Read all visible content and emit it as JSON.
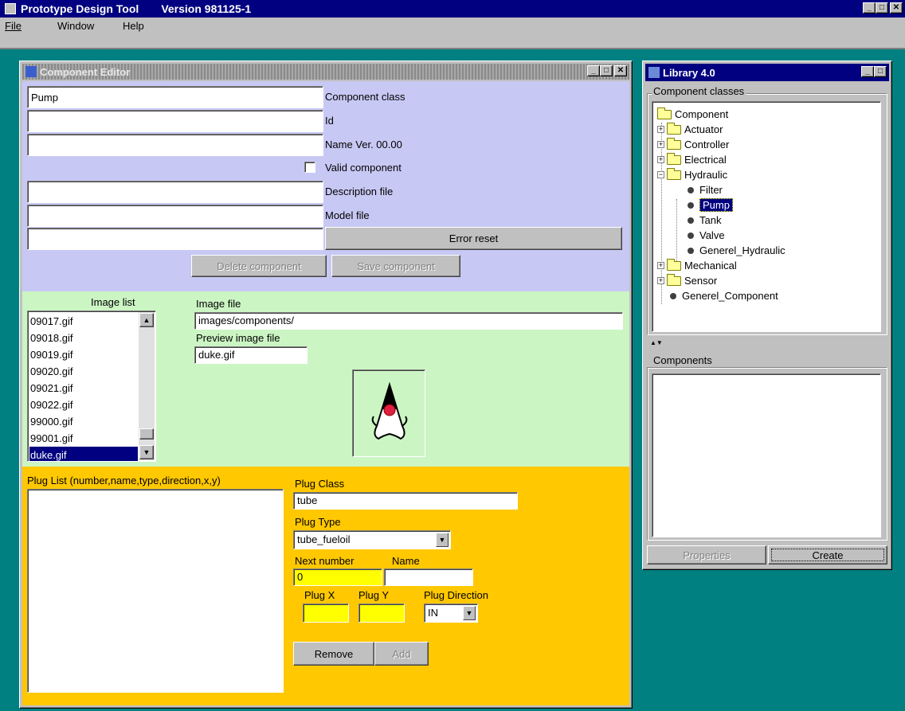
{
  "app": {
    "title": "Prototype Design Tool",
    "version": "Version 981125-1",
    "menu": [
      "File",
      "Window",
      "Help"
    ]
  },
  "colors": {
    "desktop": "#008080",
    "editor_top": "#c8c8f5",
    "editor_mid": "#ccf5c4",
    "editor_bottom": "#ffc800",
    "titlebar_active": "#000080"
  },
  "editor": {
    "title": "Component Editor",
    "component_class_value": "Pump",
    "component_class_label": "Component class",
    "id_value": "",
    "id_label": "Id",
    "name_value": "",
    "name_label": "Name Ver. 00.00",
    "valid_label": "Valid component",
    "valid_checked": false,
    "description_value": "",
    "description_label": "Description file",
    "model_value": "",
    "model_label": "Model file",
    "error_value": "",
    "error_reset_label": "Error reset",
    "delete_label": "Delete component",
    "save_label": "Save component",
    "image_list_label": "Image list",
    "image_list": [
      "09017.gif",
      "09018.gif",
      "09019.gif",
      "09020.gif",
      "09021.gif",
      "09022.gif",
      "99000.gif",
      "99001.gif",
      "duke.gif"
    ],
    "selected_image": "duke.gif",
    "image_file_label": "Image file",
    "image_file_value": "images/components/",
    "preview_label": "Preview image file",
    "preview_value": "duke.gif",
    "plug_list_label": "Plug List (number,name,type,direction,x,y)",
    "plug_class_label": "Plug Class",
    "plug_class_value": "tube",
    "plug_type_label": "Plug Type",
    "plug_type_value": "tube_fueloil",
    "next_number_label": "Next number",
    "next_number_value": "0",
    "name_field_label": "Name",
    "name_field_value": "",
    "plug_x_label": "Plug X",
    "plug_x_value": "",
    "plug_y_label": "Plug Y",
    "plug_y_value": "",
    "plug_direction_label": "Plug Direction",
    "plug_direction_value": "IN",
    "remove_label": "Remove",
    "add_label": "Add"
  },
  "library": {
    "title": "Library 4.0",
    "classes_label": "Component classes",
    "tree": {
      "root": "Component",
      "groups": [
        "Actuator",
        "Controller",
        "Electrical"
      ],
      "open_group": "Hydraulic",
      "open_children": [
        "Filter",
        "Pump",
        "Tank",
        "Valve",
        "Generel_Hydraulic"
      ],
      "selected": "Pump",
      "groups_after": [
        "Mechanical",
        "Sensor"
      ],
      "root_leaf": "Generel_Component"
    },
    "components_label": "Components",
    "properties_label": "Properties",
    "create_label": "Create"
  }
}
